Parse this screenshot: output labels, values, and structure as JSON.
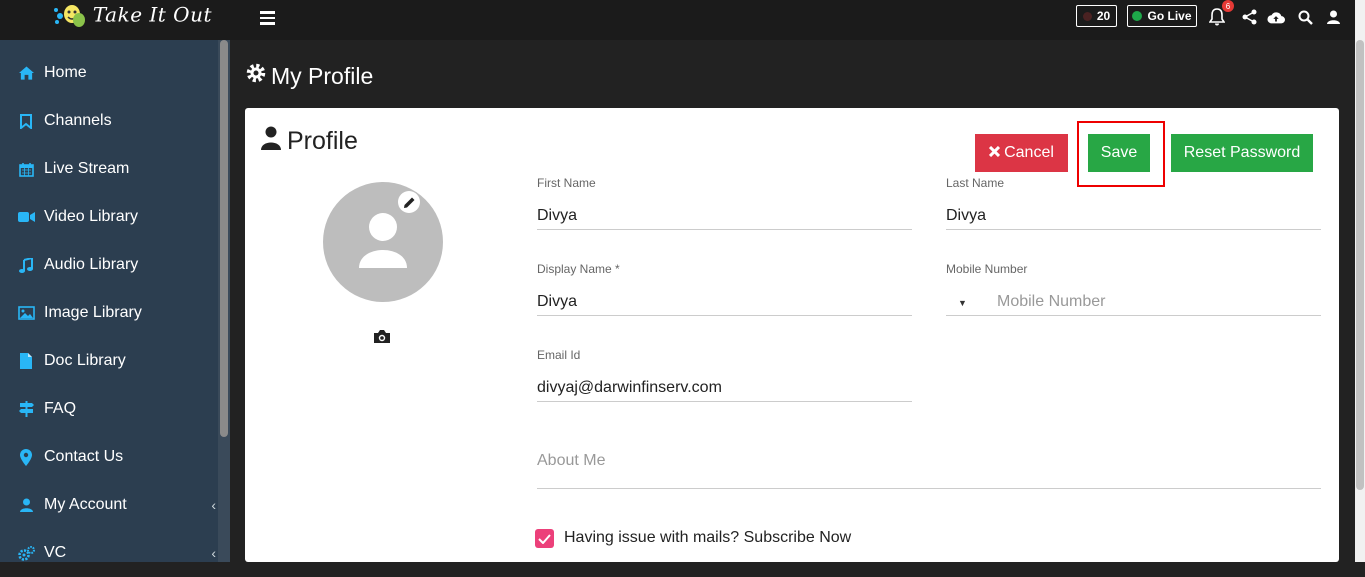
{
  "app": {
    "logo_text": "Take It Out"
  },
  "sidebar": {
    "items": [
      {
        "label": "Home",
        "icon": "home-icon"
      },
      {
        "label": "Channels",
        "icon": "bookmark-icon"
      },
      {
        "label": "Live Stream",
        "icon": "calendar-icon"
      },
      {
        "label": "Video Library",
        "icon": "video-camera-icon"
      },
      {
        "label": "Audio Library",
        "icon": "music-note-icon"
      },
      {
        "label": "Image Library",
        "icon": "image-icon"
      },
      {
        "label": "Doc Library",
        "icon": "document-icon"
      },
      {
        "label": "FAQ",
        "icon": "signpost-icon"
      },
      {
        "label": "Contact Us",
        "icon": "map-pin-icon"
      },
      {
        "label": "My Account",
        "icon": "user-icon",
        "expandable": true
      },
      {
        "label": "VC",
        "icon": "cogs-icon",
        "expandable": true
      }
    ]
  },
  "topbar": {
    "counter_value": "20",
    "go_live_label": "Go Live",
    "notification_count": "6"
  },
  "page": {
    "title": "My Profile"
  },
  "profile": {
    "card_title": "Profile",
    "buttons": {
      "cancel": "Cancel",
      "save": "Save",
      "reset_password": "Reset Password"
    },
    "fields": {
      "first_name": {
        "label": "First Name",
        "value": "Divya"
      },
      "last_name": {
        "label": "Last Name",
        "value": "Divya"
      },
      "display_name": {
        "label": "Display Name *",
        "value": "Divya"
      },
      "mobile_number": {
        "label": "Mobile Number",
        "placeholder": "Mobile Number",
        "value": ""
      },
      "email": {
        "label": "Email Id",
        "value": "divyaj@darwinfinserv.com"
      },
      "about_me": {
        "placeholder": "About Me",
        "value": ""
      }
    },
    "subscribe": {
      "label": "Having issue with mails? Subscribe Now",
      "checked": true
    }
  },
  "colors": {
    "sidebar_bg": "#2c3e50",
    "topbar_bg": "#1b1b1b",
    "icon_accent": "#29b6f6",
    "cancel_red": "#dc3545",
    "save_green": "#28a745",
    "highlight_red": "#ee0000",
    "checkbox_pink": "#ec407a"
  }
}
